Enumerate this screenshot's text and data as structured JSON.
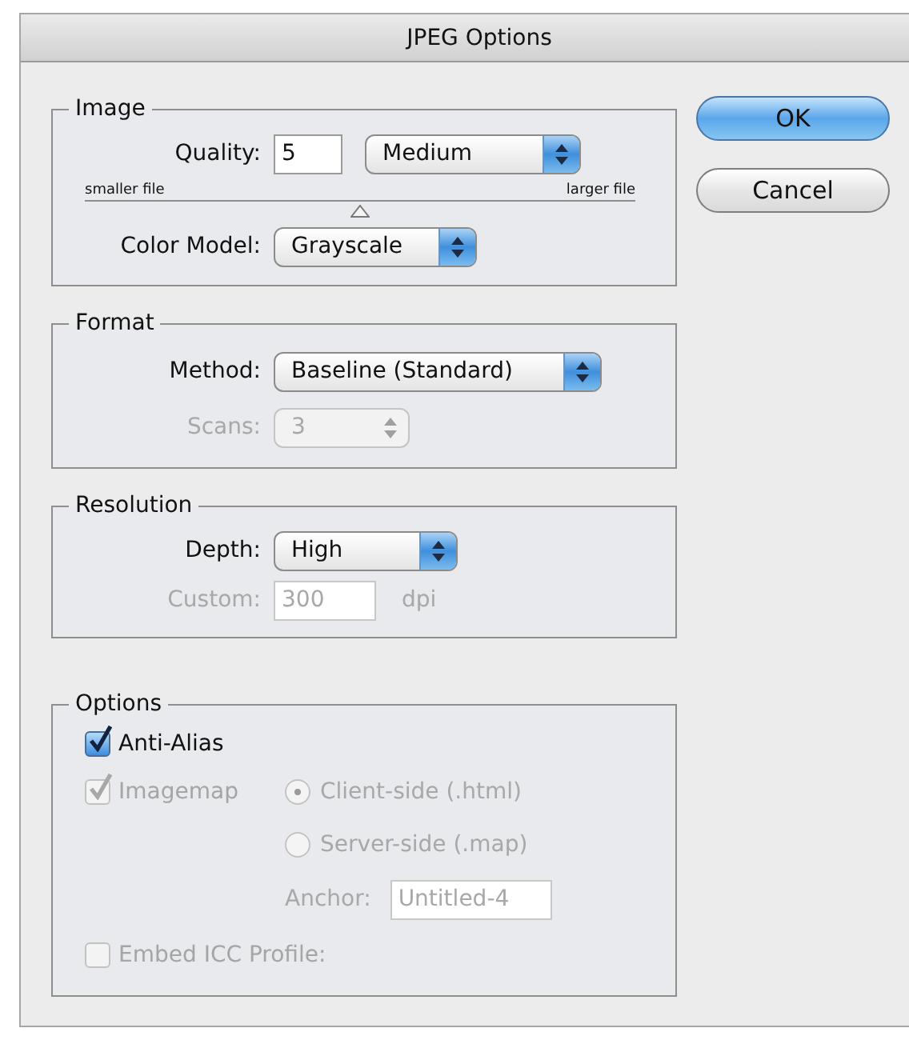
{
  "window": {
    "title": "JPEG Options"
  },
  "image": {
    "title": "Image",
    "quality": {
      "label": "Quality:",
      "value": "5",
      "preset": "Medium"
    },
    "slider": {
      "min_label": "smaller file",
      "max_label": "larger file",
      "level": 0.5
    },
    "color_model": {
      "label": "Color Model:",
      "value": "Grayscale"
    }
  },
  "format": {
    "title": "Format",
    "method": {
      "label": "Method:",
      "value": "Baseline (Standard)"
    },
    "scans": {
      "label": "Scans:",
      "value": "3",
      "disabled": true
    }
  },
  "resolution": {
    "title": "Resolution",
    "depth": {
      "label": "Depth:",
      "value": "High"
    },
    "custom": {
      "label": "Custom:",
      "value": "300",
      "unit": "dpi",
      "disabled": true
    }
  },
  "options": {
    "title": "Options",
    "anti_alias": {
      "label": "Anti-Alias",
      "checked": true,
      "disabled": false
    },
    "imagemap": {
      "label": "Imagemap",
      "checked": true,
      "disabled": true
    },
    "radios": [
      {
        "label": "Client-side (.html)",
        "selected": true,
        "disabled": true
      },
      {
        "label": "Server-side (.map)",
        "selected": false,
        "disabled": true
      }
    ],
    "anchor": {
      "label": "Anchor:",
      "value": "Untitled-4",
      "disabled": true
    },
    "embed_icc": {
      "label": "Embed ICC Profile:",
      "checked": false,
      "disabled": true
    }
  },
  "buttons": [
    {
      "label": "OK",
      "default": true
    },
    {
      "label": "Cancel",
      "default": false
    }
  ]
}
